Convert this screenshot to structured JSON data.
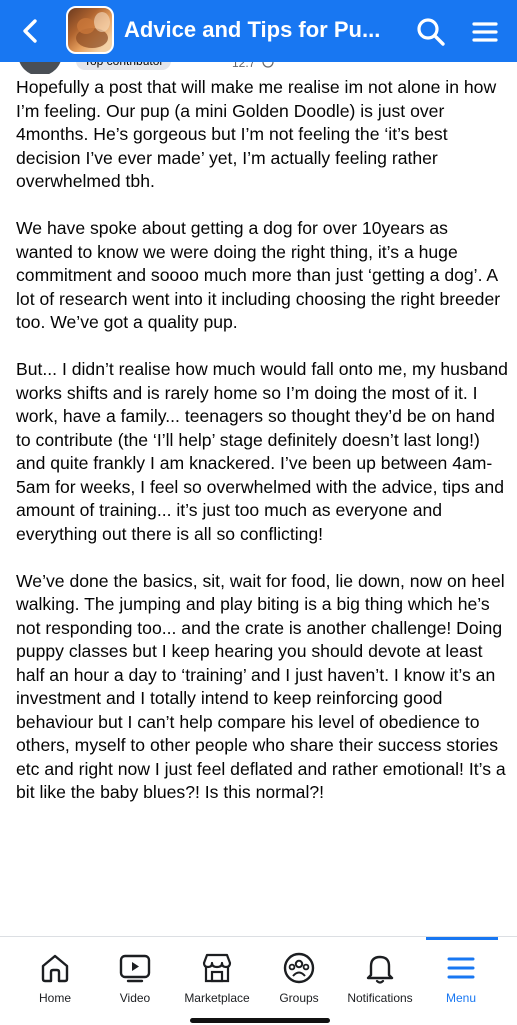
{
  "header": {
    "title": "Advice and Tips for Pu...",
    "bg_color": "#1877f2"
  },
  "author": {
    "badge": "Top contributor",
    "time": "12.7"
  },
  "post": {
    "paragraphs": [
      "Hopefully a post that will make me realise im not alone in how I’m feeling. Our pup (a mini Golden Doodle) is just over 4months. He’s gorgeous but I’m not feeling the ‘it’s best decision I’ve ever made’ yet, I’m actually feeling rather overwhelmed tbh.",
      "We have spoke about getting a dog for over 10years as wanted to know we were doing the right thing, it’s a huge commitment and soooo much more than just ‘getting a dog’. A lot of research went into it including choosing the right breeder too. We’ve got a quality pup.",
      "But... I didn’t realise how much would fall onto me, my husband works shifts and is rarely home so I’m doing the most of it. I work, have a family... teenagers so thought they’d be on hand to contribute (the ‘I’ll help’ stage definitely doesn’t last long!) and quite frankly I am knackered. I’ve been up between 4am-5am for weeks, I feel so overwhelmed with the advice, tips and amount of training... it’s just too much as everyone and everything out there is all so conflicting!",
      "We’ve done the basics, sit, wait for food, lie down, now on heel walking. The jumping and play biting is a big thing which he’s not responding too... and the crate is another challenge! Doing puppy classes but I keep hearing you should devote at least half an hour a day to ‘training’ and I just haven’t. I know it’s an investment and I totally intend to keep reinforcing good behaviour but I can’t help compare his level of obedience to others, myself to other people who share their success stories etc and right now I just feel deflated and rather emotional! It’s a bit like the baby blues?! Is this normal?!"
    ]
  },
  "nav": {
    "items": [
      {
        "label": "Home",
        "icon": "home-icon"
      },
      {
        "label": "Video",
        "icon": "video-icon"
      },
      {
        "label": "Marketplace",
        "icon": "marketplace-icon"
      },
      {
        "label": "Groups",
        "icon": "groups-icon"
      },
      {
        "label": "Notifications",
        "icon": "bell-icon"
      },
      {
        "label": "Menu",
        "icon": "menu-icon"
      }
    ],
    "active_index": 5,
    "active_color": "#1877f2"
  }
}
